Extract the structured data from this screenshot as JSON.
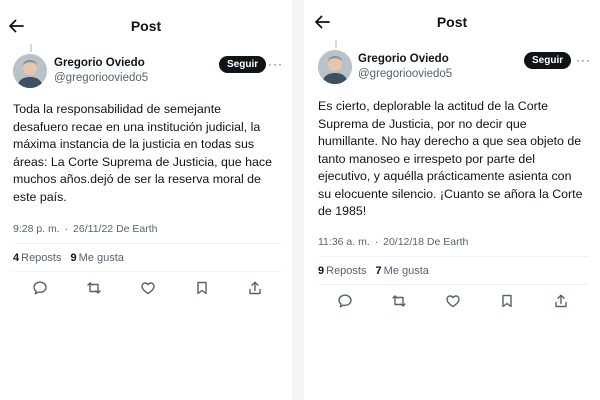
{
  "left": {
    "header_title": "Post",
    "author": {
      "name": "Gregorio Oviedo",
      "handle": "@gregoriooviedo5"
    },
    "follow_label": "Seguir",
    "more_label": "···",
    "text": "Toda la responsabilidad de semejante\ndesafuero recae en una institución judicial, la\nmáxima instancia de la justicia en todas sus\náreas: La Corte Suprema de Justicia, que hace\nmuchos años.dejó de ser la reserva moral de\neste país.",
    "time": "9:28 p. m.",
    "separator": "·",
    "date": "26/11/22",
    "source": "De Earth",
    "reposts_count": "4",
    "reposts_label": "Reposts",
    "likes_count": "9",
    "likes_label": "Me gusta"
  },
  "right": {
    "header_title": "Post",
    "author": {
      "name": "Gregorio Oviedo",
      "handle": "@gregoriooviedo5"
    },
    "follow_label": "Seguir",
    "more_label": "···",
    "text": "Es cierto, deplorable la actitud de la Corte\nSuprema de Justicia, por no decir que\nhumillante. No hay derecho a que sea objeto de\ntanto manoseo e irrespeto por parte del\nejecutivo, y aquélla prácticamente asienta con\nsu elocuente silencio. ¡Cuanto se añora la Corte\nde 1985!",
    "time": "11:36 a. m.",
    "separator": "·",
    "date": "20/12/18",
    "source": "De Earth",
    "reposts_count": "9",
    "reposts_label": "Reposts",
    "likes_count": "7",
    "likes_label": "Me gusta"
  },
  "icons": [
    "back-arrow-icon",
    "reply-icon",
    "repost-icon",
    "like-icon",
    "bookmark-icon",
    "share-icon"
  ],
  "colors": {
    "text": "#0f1419",
    "secondary": "#536471",
    "follow_bg": "#0f1419",
    "divider": "#eff3f4"
  }
}
